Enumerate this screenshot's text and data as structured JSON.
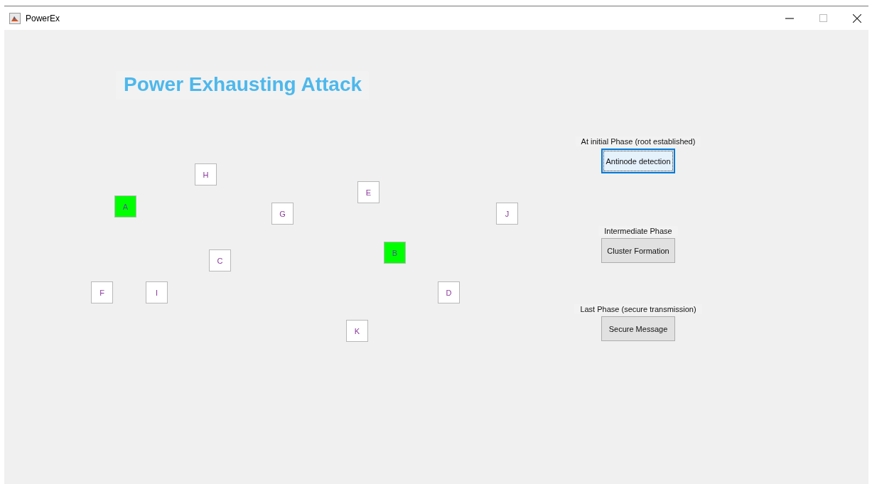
{
  "window": {
    "title": "PowerEx"
  },
  "heading": "Power Exhausting Attack",
  "nodes": [
    {
      "label": "H",
      "highlighted": false
    },
    {
      "label": "E",
      "highlighted": false
    },
    {
      "label": "A",
      "highlighted": true
    },
    {
      "label": "G",
      "highlighted": false
    },
    {
      "label": "J",
      "highlighted": false
    },
    {
      "label": "B",
      "highlighted": true
    },
    {
      "label": "C",
      "highlighted": false
    },
    {
      "label": "F",
      "highlighted": false
    },
    {
      "label": "I",
      "highlighted": false
    },
    {
      "label": "D",
      "highlighted": false
    },
    {
      "label": "K",
      "highlighted": false
    }
  ],
  "phases": [
    {
      "label": "At initial Phase (root established)",
      "button": "Antinode detection",
      "focused": true
    },
    {
      "label": "Intermediate Phase",
      "button": "Cluster Formation",
      "focused": false
    },
    {
      "label": "Last Phase (secure transmission)",
      "button": "Secure Message",
      "focused": false
    }
  ]
}
